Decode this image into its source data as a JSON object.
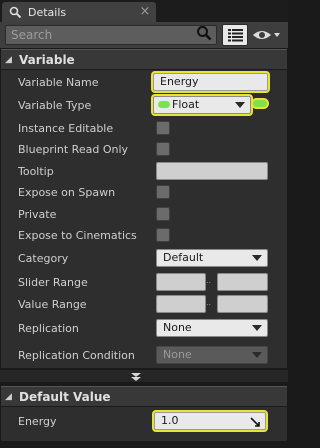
{
  "tab": {
    "title": "Details",
    "close_glyph": "×",
    "icon": "magnifier-icon"
  },
  "toolbar": {
    "search_placeholder": "Search",
    "search_icon": "search-icon",
    "view_icon": "list-view-icon",
    "visibility_icon": "eye-icon"
  },
  "variable_section": {
    "title": "Variable"
  },
  "rows": {
    "variable_name": {
      "label": "Variable Name",
      "value": "Energy"
    },
    "variable_type": {
      "label": "Variable Type",
      "value": "Float",
      "type_color": "#7ee24a"
    },
    "instance_editable": {
      "label": "Instance Editable"
    },
    "blueprint_read_only": {
      "label": "Blueprint Read Only"
    },
    "tooltip": {
      "label": "Tooltip",
      "value": ""
    },
    "expose_on_spawn": {
      "label": "Expose on Spawn"
    },
    "private": {
      "label": "Private"
    },
    "expose_to_cinematics": {
      "label": "Expose to Cinematics"
    },
    "category": {
      "label": "Category",
      "value": "Default"
    },
    "slider_range": {
      "label": "Slider Range",
      "separator": ".."
    },
    "value_range": {
      "label": "Value Range",
      "separator": ".."
    },
    "replication": {
      "label": "Replication",
      "value": "None"
    },
    "replication_condition": {
      "label": "Replication Condition",
      "value": "None"
    }
  },
  "default_section": {
    "title": "Default Value"
  },
  "default_rows": {
    "energy": {
      "label": "Energy",
      "value": "1.0"
    }
  },
  "colors": {
    "highlight": "#e8e432",
    "panel": "#2e2e2e",
    "header": "#383838"
  }
}
